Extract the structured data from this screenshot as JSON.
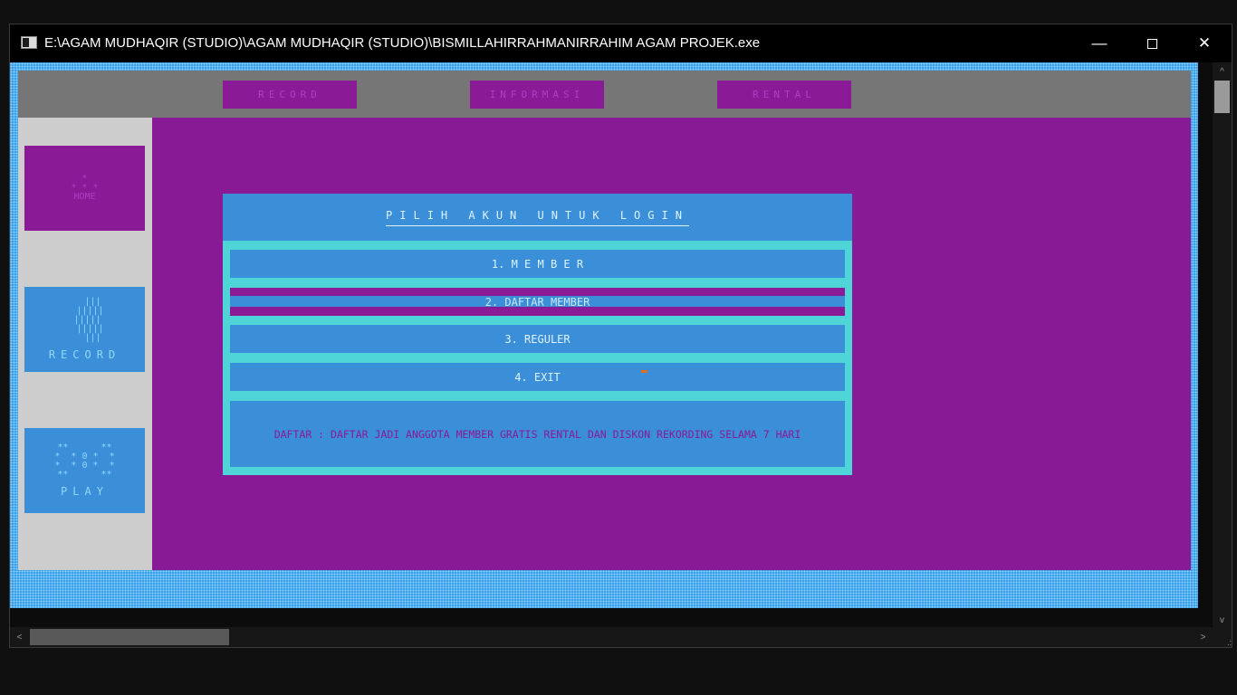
{
  "window": {
    "title": "E:\\AGAM MUDHAQIR (STUDIO)\\AGAM MUDHAQIR (STUDIO)\\BISMILLAHIRRAHMANIRRAHIM AGAM PROJEK.exe",
    "minimize_glyph": "—",
    "close_glyph": "✕"
  },
  "nav": {
    "btn1": "RECORD",
    "btn2": "INFORMASI",
    "btn3": "RENTAL"
  },
  "sidebar": {
    "tile1": {
      "art": "*\n* * *\nHOME",
      "label": ""
    },
    "tile2": {
      "art": "   |||\n  |||||\n |||||\n  |||||\n   |||",
      "label": "RECORD"
    },
    "tile3": {
      "art": "**      **\n*  * 0 *  *\n*  * 0 *  *\n**      **",
      "label": "PLAY"
    }
  },
  "dialog": {
    "title": "PILIH AKUN UNTUK LOGIN",
    "items": [
      {
        "label": "1. M E M B E R"
      },
      {
        "label": "2. DAFTAR MEMBER"
      },
      {
        "label": "3. REGULER"
      },
      {
        "label": "4. EXIT"
      }
    ],
    "info": "DAFTAR : DAFTAR JADI ANGGOTA MEMBER GRATIS RENTAL DAN DISKON REKORDING SELAMA 7 HARI"
  },
  "scroll": {
    "up": "^",
    "down": "v",
    "left": "<",
    "right": ">",
    "grip": ".:"
  },
  "colors": {
    "frame": "#3aa0e8",
    "purple": "#881a96",
    "blue": "#3a8fd8",
    "cyan": "#4fd4d8",
    "gray": "#767676",
    "light_gray": "#cdcdcd"
  }
}
